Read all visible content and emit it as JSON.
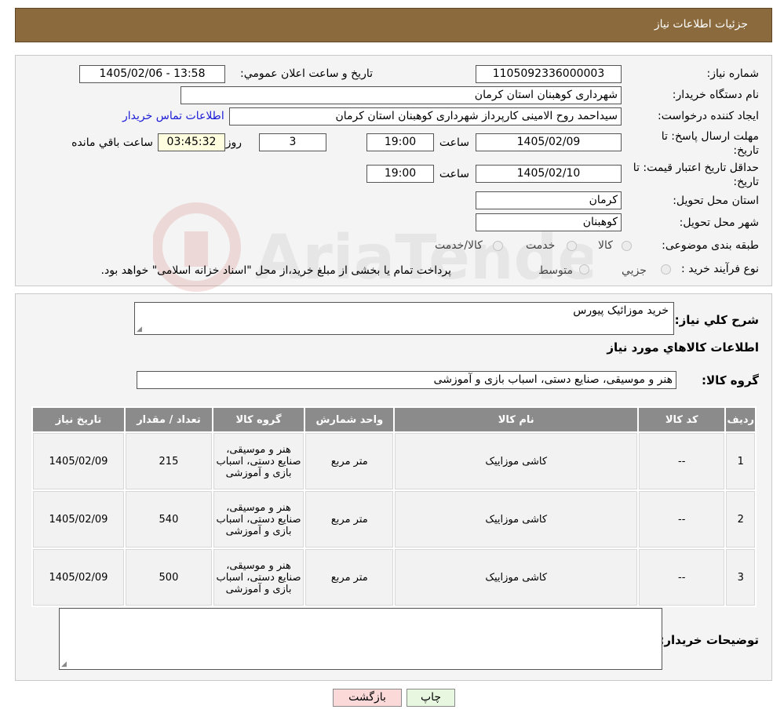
{
  "header": {
    "title": "جزئیات اطلاعات نیاز"
  },
  "need_number": {
    "label": "شماره نیاز:",
    "value": "1105092336000003"
  },
  "announce": {
    "label": "تاریخ و ساعت اعلان عمومي:",
    "value": "1405/02/06 - 13:58"
  },
  "buyer_org": {
    "label": "نام دستگاه خریدار:",
    "value": "شهرداری کوهبنان استان کرمان"
  },
  "creator": {
    "label": "ایجاد کننده درخواست:",
    "value": "سیداحمد روح الامینی کارپرداز شهرداری کوهبنان استان کرمان",
    "contact_link": "اطلاعات تماس خریدار"
  },
  "deadline": {
    "label_line1": "مهلت ارسال پاسخ: تا",
    "label_line2": "تاریخ:",
    "date": "1405/02/09",
    "time_label": "ساعت",
    "time": "19:00",
    "days": "3",
    "days_label": "روز و",
    "remaining": "03:45:32",
    "remaining_label": "ساعت باقي مانده"
  },
  "validity": {
    "label_line1": "حداقل تاریخ اعتبار قیمت: تا",
    "label_line2": "تاریخ:",
    "date": "1405/02/10",
    "time_label": "ساعت",
    "time": "19:00"
  },
  "province": {
    "label": "استان محل تحویل:",
    "value": "کرمان"
  },
  "city": {
    "label": "شهر محل تحویل:",
    "value": "کوهبنان"
  },
  "category": {
    "label": "طبقه بندی موضوعی:",
    "options": [
      "کالا",
      "خدمت",
      "کالا/خدمت"
    ]
  },
  "process": {
    "label": "نوع فرآیند خرید :",
    "options": [
      "جزيي",
      "متوسط"
    ],
    "note": "پرداخت تمام یا بخشی از مبلغ خرید،از محل \"اسناد خزانه اسلامی\" خواهد بود."
  },
  "summary": {
    "label": "شرح كلي نياز:",
    "value": "خرید موزائیک  پیورس"
  },
  "goods_info_title": "اطلاعات كالاهاي مورد نياز",
  "goods_group": {
    "label": "گروه کالا:",
    "value": "هنر و موسیقی، صنایع دستی، اسباب بازی و آموزشی"
  },
  "table": {
    "headers": [
      "رديف",
      "کد کالا",
      "نام کالا",
      "واحد شمارش",
      "گروه کالا",
      "تعداد / مقدار",
      "تاریخ نیاز"
    ],
    "rows": [
      [
        "1",
        "--",
        "کاشی موزاییک",
        "متر مربع",
        "هنر و موسیقی، صنایع دستی، اسباب بازی و آموزشی",
        "215",
        "1405/02/09"
      ],
      [
        "2",
        "--",
        "کاشی موزاییک",
        "متر مربع",
        "هنر و موسیقی، صنایع دستی، اسباب بازی و آموزشی",
        "540",
        "1405/02/09"
      ],
      [
        "3",
        "--",
        "کاشی موزاییک",
        "متر مربع",
        "هنر و موسیقی، صنایع دستی، اسباب بازی و آموزشی",
        "500",
        "1405/02/09"
      ]
    ]
  },
  "buyer_notes": {
    "label": "توضیحات خریدار:",
    "value": ""
  },
  "buttons": {
    "print": "چاپ",
    "back": "بازگشت"
  },
  "watermark_text": "AriaTender.neT",
  "colors": {
    "header_bg": "#8b6a3d",
    "table_header_bg": "#8b8b8b",
    "back_button_bg": "#fbd9d9",
    "print_button_bg": "#e8f7e0",
    "link": "#1a1ad6"
  }
}
